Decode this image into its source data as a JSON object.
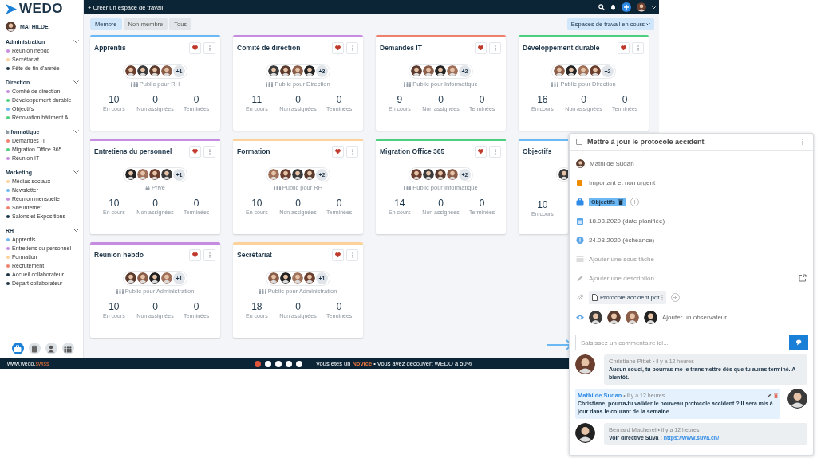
{
  "sidebar": {
    "logo": "WEDO",
    "user": "MATHILDE",
    "groups": [
      {
        "title": "Administration",
        "expanded": true,
        "items": [
          {
            "label": "Réunion hebdo",
            "color": "#c58ce0"
          },
          {
            "label": "Secrétariat",
            "color": "#fcd29a"
          },
          {
            "label": "Fête de fin d'année",
            "color": "#1c3448"
          }
        ]
      },
      {
        "title": "Direction",
        "expanded": true,
        "items": [
          {
            "label": "Comité de direction",
            "color": "#c58ce0"
          },
          {
            "label": "Développement durable",
            "color": "#4cd07d"
          },
          {
            "label": "Objectifs",
            "color": "#6bb8f5"
          },
          {
            "label": "Rénovation bâtiment A",
            "color": "#4cd07d"
          }
        ]
      },
      {
        "title": "Informatique",
        "expanded": true,
        "items": [
          {
            "label": "Demandes IT",
            "color": "#f0806e"
          },
          {
            "label": "Migration Office 365",
            "color": "#4cd07d"
          },
          {
            "label": "Réunion IT",
            "color": "#c58ce0"
          }
        ]
      },
      {
        "title": "Marketing",
        "expanded": true,
        "items": [
          {
            "label": "Médias sociaux",
            "color": "#fcd29a"
          },
          {
            "label": "Newsletter",
            "color": "#6bb8f5"
          },
          {
            "label": "Réunion mensuelle",
            "color": "#c58ce0"
          },
          {
            "label": "Site internet",
            "color": "#f0806e"
          },
          {
            "label": "Salons et Expositions",
            "color": "#1c3448"
          }
        ]
      },
      {
        "title": "RH",
        "expanded": true,
        "items": [
          {
            "label": "Apprentis",
            "color": "#6bb8f5"
          },
          {
            "label": "Entretiens du personnel",
            "color": "#c58ce0"
          },
          {
            "label": "Formation",
            "color": "#fcd29a"
          },
          {
            "label": "Recrutement",
            "color": "#f0806e"
          },
          {
            "label": "Accueil collaborateur",
            "color": "#1c3448"
          },
          {
            "label": "Départ collaborateur",
            "color": "#1c3448"
          }
        ]
      }
    ],
    "nav": [
      {
        "kind": "workspaces",
        "selected": true
      },
      {
        "kind": "tasks",
        "selected": false
      },
      {
        "kind": "user",
        "selected": false
      },
      {
        "kind": "team",
        "selected": false
      }
    ]
  },
  "topbar": {
    "create": "+ Créer un espace de travail"
  },
  "filters": [
    {
      "label": "Membre",
      "selected": true
    },
    {
      "label": "Non-membre",
      "selected": false
    },
    {
      "label": "Tous",
      "selected": false
    }
  ],
  "status_filter": "Espaces de travail en cours",
  "cards": [
    {
      "title": "Apprentis",
      "color": "#6bb8f5",
      "favorite": true,
      "extra": "+1",
      "visibility": "Public pour RH",
      "private": false,
      "stats": [
        {
          "value": "10",
          "label": "En cours"
        },
        {
          "value": "0",
          "label": "Non assignées"
        },
        {
          "value": "0",
          "label": "Terminées"
        }
      ]
    },
    {
      "title": "Comité de direction",
      "color": "#c58ce0",
      "favorite": true,
      "extra": "+3",
      "visibility": "Public pour Direction",
      "private": false,
      "stats": [
        {
          "value": "11",
          "label": "En cours"
        },
        {
          "value": "0",
          "label": "Non assignées"
        },
        {
          "value": "0",
          "label": "Terminées"
        }
      ]
    },
    {
      "title": "Demandes IT",
      "color": "#f0806e",
      "favorite": true,
      "extra": "+2",
      "visibility": "Public pour Informatique",
      "private": false,
      "stats": [
        {
          "value": "9",
          "label": "En cours"
        },
        {
          "value": "0",
          "label": "Non assignées"
        },
        {
          "value": "0",
          "label": "Terminées"
        }
      ]
    },
    {
      "title": "Développement durable",
      "color": "#4cd07d",
      "favorite": true,
      "extra": "+2",
      "visibility": "Public pour Direction",
      "private": false,
      "stats": [
        {
          "value": "16",
          "label": "En cours"
        },
        {
          "value": "0",
          "label": "Non assignées"
        },
        {
          "value": "0",
          "label": "Terminées"
        }
      ]
    },
    {
      "title": "Entretiens du personnel",
      "color": "#c58ce0",
      "favorite": true,
      "extra": "+1",
      "visibility": "Privé",
      "private": true,
      "stats": [
        {
          "value": "10",
          "label": "En cours"
        },
        {
          "value": "0",
          "label": "Non assignées"
        },
        {
          "value": "0",
          "label": "Terminées"
        }
      ]
    },
    {
      "title": "Formation",
      "color": "#fcd29a",
      "favorite": true,
      "extra": "+2",
      "visibility": "Public pour RH",
      "private": false,
      "stats": [
        {
          "value": "10",
          "label": "En cours"
        },
        {
          "value": "0",
          "label": "Non assignées"
        },
        {
          "value": "0",
          "label": "Terminées"
        }
      ]
    },
    {
      "title": "Migration Office 365",
      "color": "#4cd07d",
      "favorite": true,
      "extra": "+2",
      "visibility": "Public pour Informatique",
      "private": false,
      "stats": [
        {
          "value": "14",
          "label": "En cours"
        },
        {
          "value": "0",
          "label": "Non assignées"
        },
        {
          "value": "0",
          "label": "Terminées"
        }
      ]
    },
    {
      "title": "Objectifs",
      "color": "#6bb8f5",
      "partial": true,
      "stats": [
        {
          "value": "10",
          "label": "En cours"
        }
      ]
    },
    {
      "title": "Réunion hebdo",
      "color": "#c58ce0",
      "favorite": true,
      "extra": "+1",
      "visibility": "Public pour Administration",
      "private": false,
      "stats": [
        {
          "value": "10",
          "label": "En cours"
        },
        {
          "value": "0",
          "label": "Non assignées"
        },
        {
          "value": "0",
          "label": "Terminées"
        }
      ]
    },
    {
      "title": "Secrétariat",
      "color": "#fcd29a",
      "favorite": true,
      "extra": "+1",
      "visibility": "Public pour Administration",
      "private": false,
      "stats": [
        {
          "value": "18",
          "label": "En cours"
        },
        {
          "value": "0",
          "label": "Non assignées"
        },
        {
          "value": "0",
          "label": "Terminées"
        }
      ]
    }
  ],
  "footer": {
    "site": "www.wedo.",
    "site_suffix": "swiss",
    "steps": [
      {
        "selected": true
      },
      {
        "selected": false
      },
      {
        "selected": false
      },
      {
        "selected": false
      },
      {
        "selected": false
      }
    ],
    "prefix": "Vous êtes un ",
    "rank": "Novice",
    "suffix": " • Vous avez découvert WEDO à 50%"
  },
  "task": {
    "title": "Mettre à jour le protocole accident",
    "checked": false,
    "rows": [
      {
        "kind": "assignee",
        "text": "Mathilde Sudan"
      },
      {
        "kind": "priority",
        "text": "Important et non urgent",
        "color": "#f08c00"
      },
      {
        "kind": "workspace",
        "text": "Objectifs"
      },
      {
        "kind": "planned",
        "text": "18.03.2020 (date planifiée)"
      },
      {
        "kind": "due",
        "text": "24.03.2020 (échéance)"
      },
      {
        "kind": "subtask",
        "text": "Ajouter une sous tâche"
      },
      {
        "kind": "description",
        "text": "Ajouter une description"
      },
      {
        "kind": "attachment",
        "text": "Protocole accident.pdf"
      },
      {
        "kind": "observers",
        "text": "Ajouter un observateur"
      }
    ],
    "comment_placeholder": "Saisissez un commentaire ici...",
    "comments": [
      {
        "author": "Christiane Pittet",
        "time": "• il y a 12 heures",
        "text": "Aucun souci, tu pourras me le transmettre dès que tu auras terminé. A bientôt.",
        "own": false
      },
      {
        "author": "Mathilde Sudan",
        "time": "• il y a 12 heures",
        "text": "Christiane, pourra-tu valider le nouveau protocole accident ? Il sera mis à jour dans le courant de la semaine.",
        "own": true
      },
      {
        "author": "Bernard Macherel",
        "time": "• il y a 12 heures",
        "text": "Voir directive Suva : ",
        "link": "https://www.suva.ch/",
        "own": false
      }
    ]
  }
}
